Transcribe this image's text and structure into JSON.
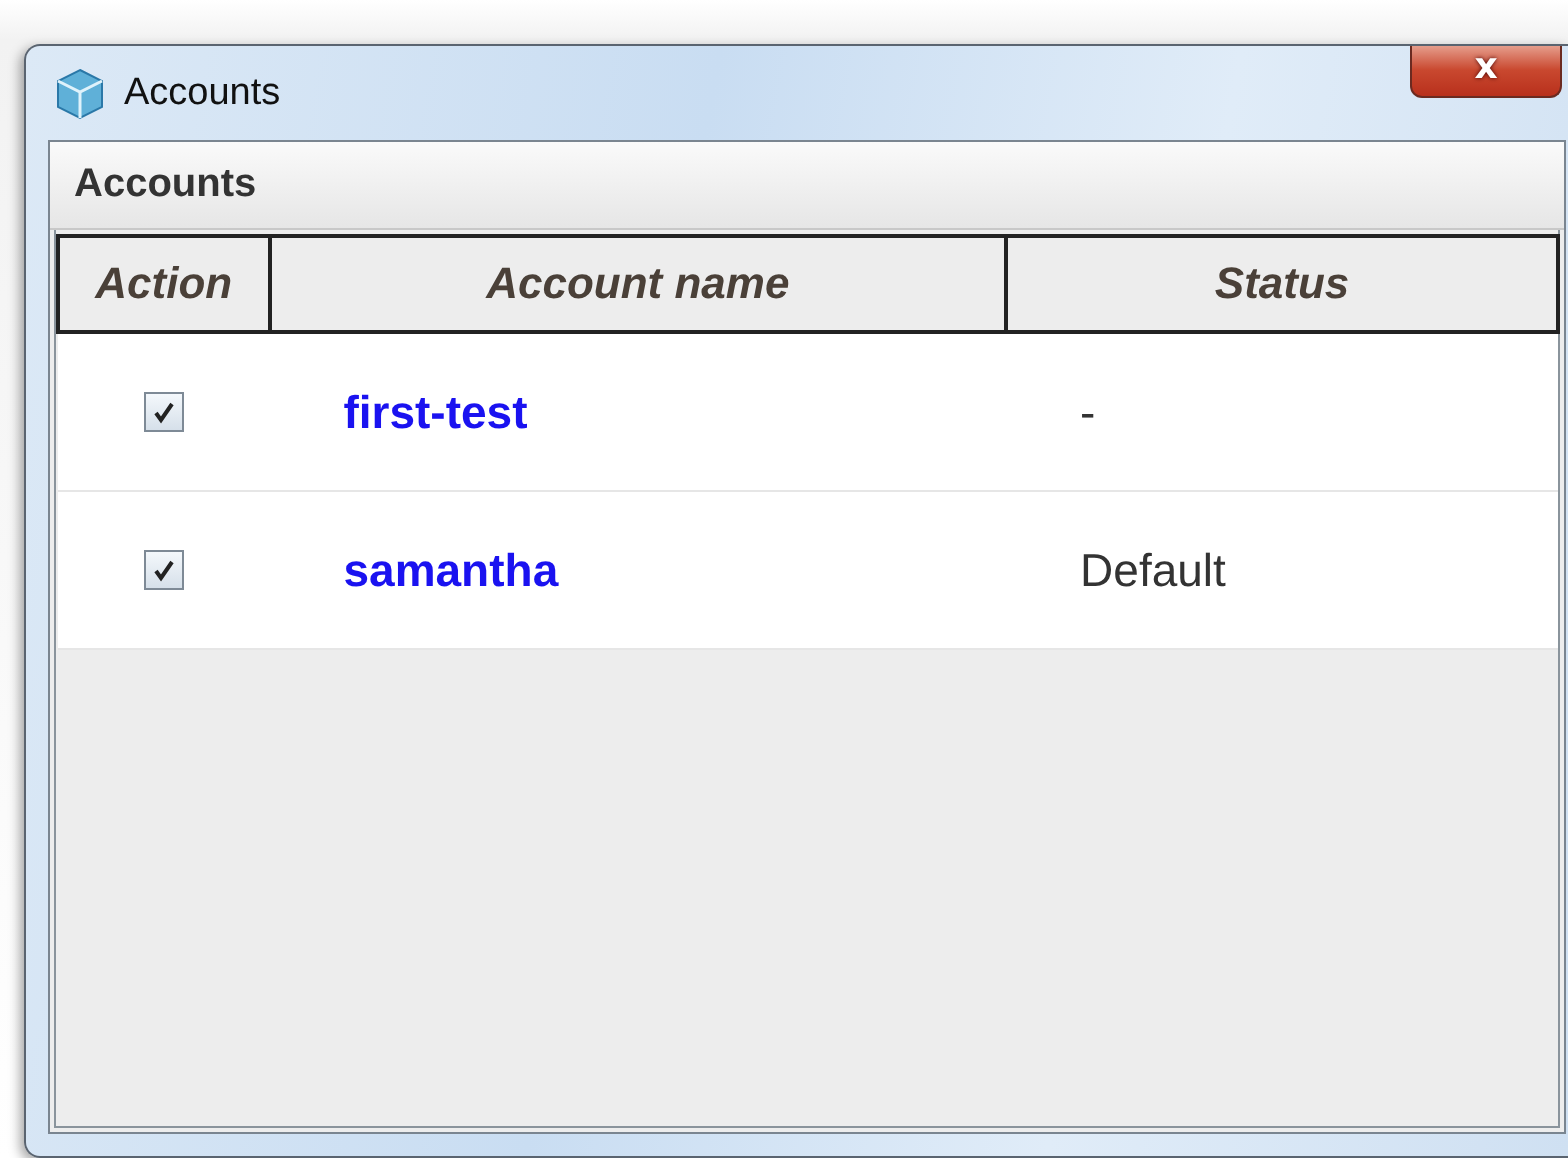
{
  "window": {
    "title": "Accounts",
    "close_label": "x"
  },
  "panel": {
    "title": "Accounts"
  },
  "table": {
    "columns": [
      "Action",
      "Account name",
      "Status"
    ],
    "rows": [
      {
        "checked": true,
        "name": "first-test",
        "status": "-"
      },
      {
        "checked": true,
        "name": "samantha",
        "status": "Default"
      }
    ]
  }
}
